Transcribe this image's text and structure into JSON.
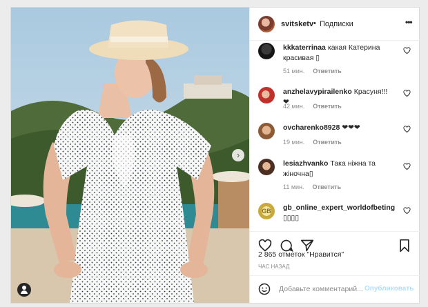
{
  "header": {
    "username": "svitsketv",
    "separator": "•",
    "follow_label": "Подписки",
    "more_label": "•••"
  },
  "comments": [
    {
      "username": "kkkaterrinaa",
      "text": "какая Катерина красивая ▯",
      "time": "51 мин.",
      "reply": "Ответить",
      "avatar": "avatar-dark"
    },
    {
      "username": "anzhelavypirailenko",
      "text": "Красуня!!!❤",
      "time": "42 мин.",
      "reply": "Ответить",
      "avatar": "avatar-red"
    },
    {
      "username": "ovcharenko8928",
      "text": "❤❤❤",
      "time": "19 мин.",
      "reply": "Ответить",
      "avatar": "avatar-warm"
    },
    {
      "username": "lesiazhvanko",
      "text": "Така ніжна та жіночна▯",
      "time": "11 мин.",
      "reply": "Ответить",
      "avatar": "avatar-brown"
    },
    {
      "username": "gb_online_expert_worldofbeting",
      "text": "▯▯▯▯",
      "avatar": "avatar-gb",
      "avatar_text": "GB"
    }
  ],
  "likes": "2 865 отметок \"Нравится\"",
  "timestamp": "час назад",
  "add_comment": {
    "placeholder": "Добавьте комментарий...",
    "publish_label": "Опубликовать"
  },
  "photo": {
    "next_label": "›"
  },
  "colors": {
    "link": "#b2dffc",
    "muted": "#8e8e8e",
    "text": "#262626",
    "border": "#dbdbdb"
  }
}
